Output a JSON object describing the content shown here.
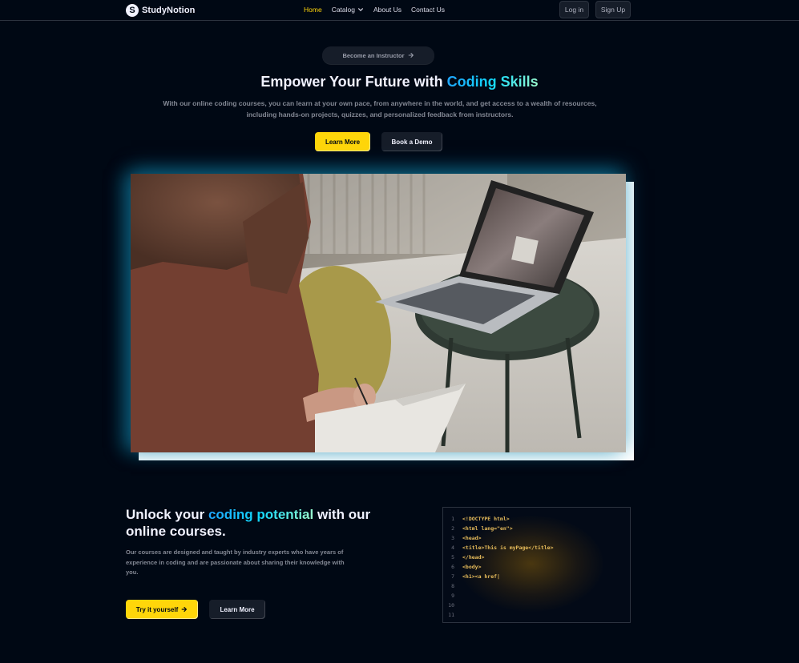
{
  "brand": {
    "name": "StudyNotion",
    "badge": "S"
  },
  "nav": {
    "links": [
      {
        "label": "Home",
        "active": true
      },
      {
        "label": "Catalog",
        "active": false,
        "dropdown": true
      },
      {
        "label": "About Us",
        "active": false
      },
      {
        "label": "Contact Us",
        "active": false
      }
    ],
    "login": "Log in",
    "signup": "Sign Up"
  },
  "hero": {
    "instructor_cta": "Become an Instructor",
    "title_plain": "Empower Your Future with ",
    "title_highlight": "Coding Skills",
    "subtitle": "With our online coding courses, you can learn at your own pace, from anywhere in the world, and get access to a wealth of resources, including hands-on projects, quizzes, and personalized feedback from instructors.",
    "primary_button": "Learn More",
    "secondary_button": "Book a Demo"
  },
  "code_section": {
    "title_part1": "Unlock your ",
    "title_highlight": "coding potential",
    "title_part2": " with our online courses.",
    "subtitle": "Our courses are designed and taught by industry experts who have years of experience in coding and are passionate about sharing their knowledge with you.",
    "primary_button": "Try it yourself",
    "secondary_button": "Learn More",
    "code_lines": [
      {
        "n": "1",
        "text": "<!DOCTYPE html>"
      },
      {
        "n": "2",
        "text": "<html lang=\"en\">"
      },
      {
        "n": "3",
        "text": "<head>"
      },
      {
        "n": "4",
        "text": "<title>This is myPage</title>"
      },
      {
        "n": "5",
        "text": "</head>"
      },
      {
        "n": "6",
        "text": "<body>"
      },
      {
        "n": "7",
        "text": "<h1><a href|"
      },
      {
        "n": "8",
        "text": ""
      },
      {
        "n": "9",
        "text": ""
      },
      {
        "n": "10",
        "text": ""
      },
      {
        "n": "11",
        "text": ""
      }
    ]
  },
  "colors": {
    "background": "#000814",
    "accent_yellow": "#FFD60A",
    "gradient_blue": "#12D8FA",
    "muted_text": "#838894"
  }
}
